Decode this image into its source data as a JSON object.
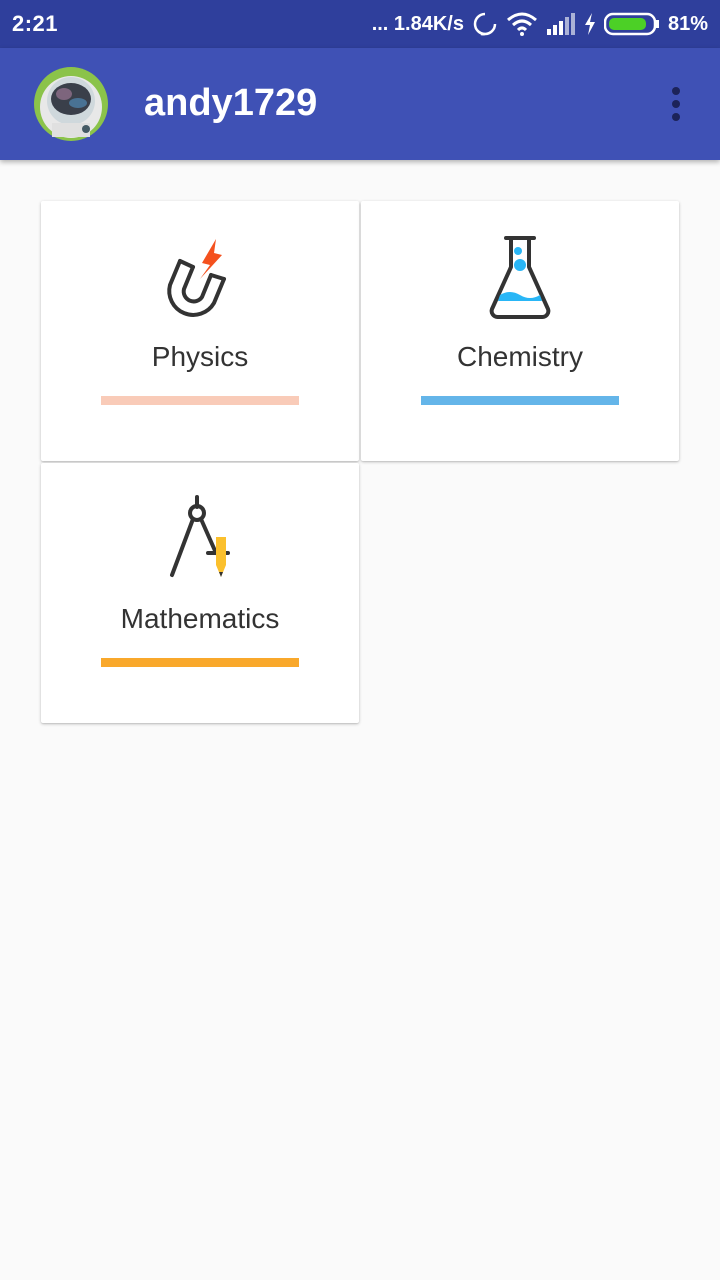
{
  "status_bar": {
    "time": "2:21",
    "network_speed": "... 1.84K/s",
    "battery_percent": "81%"
  },
  "app_bar": {
    "username": "andy1729"
  },
  "subjects": [
    {
      "label": "Physics",
      "icon": "magnet-icon",
      "accent_color": "#f9cbb8"
    },
    {
      "label": "Chemistry",
      "icon": "flask-icon",
      "accent_color": "#64b5e9"
    },
    {
      "label": "Mathematics",
      "icon": "compass-icon",
      "accent_color": "#f9a82b"
    }
  ],
  "colors": {
    "status_bar": "#2f3f9c",
    "app_bar": "#3f51b5",
    "background": "#fafafa"
  }
}
